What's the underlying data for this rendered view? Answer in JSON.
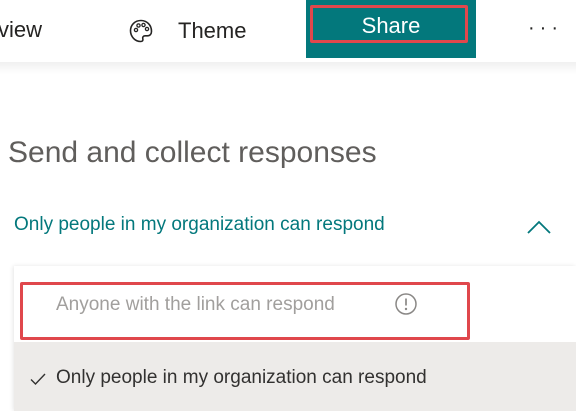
{
  "toolbar": {
    "preview_label": "view",
    "theme_label": "Theme",
    "share_label": "Share",
    "more_label": "···"
  },
  "panel": {
    "title": "Send and collect responses",
    "selected_option": "Only people in my organization can respond",
    "options": [
      {
        "label": "Anyone with the link can respond",
        "disabled": true
      },
      {
        "label": "Only people in my organization can respond",
        "selected": true
      }
    ]
  },
  "colors": {
    "accent": "#03787c",
    "highlight_outline": "#e0474c",
    "disabled_text": "#a19f9d",
    "selected_bg": "#edebe9"
  },
  "icons": {
    "theme": "palette-icon",
    "collapse": "chevron-up-icon",
    "info": "info-icon",
    "check": "checkmark-icon"
  }
}
